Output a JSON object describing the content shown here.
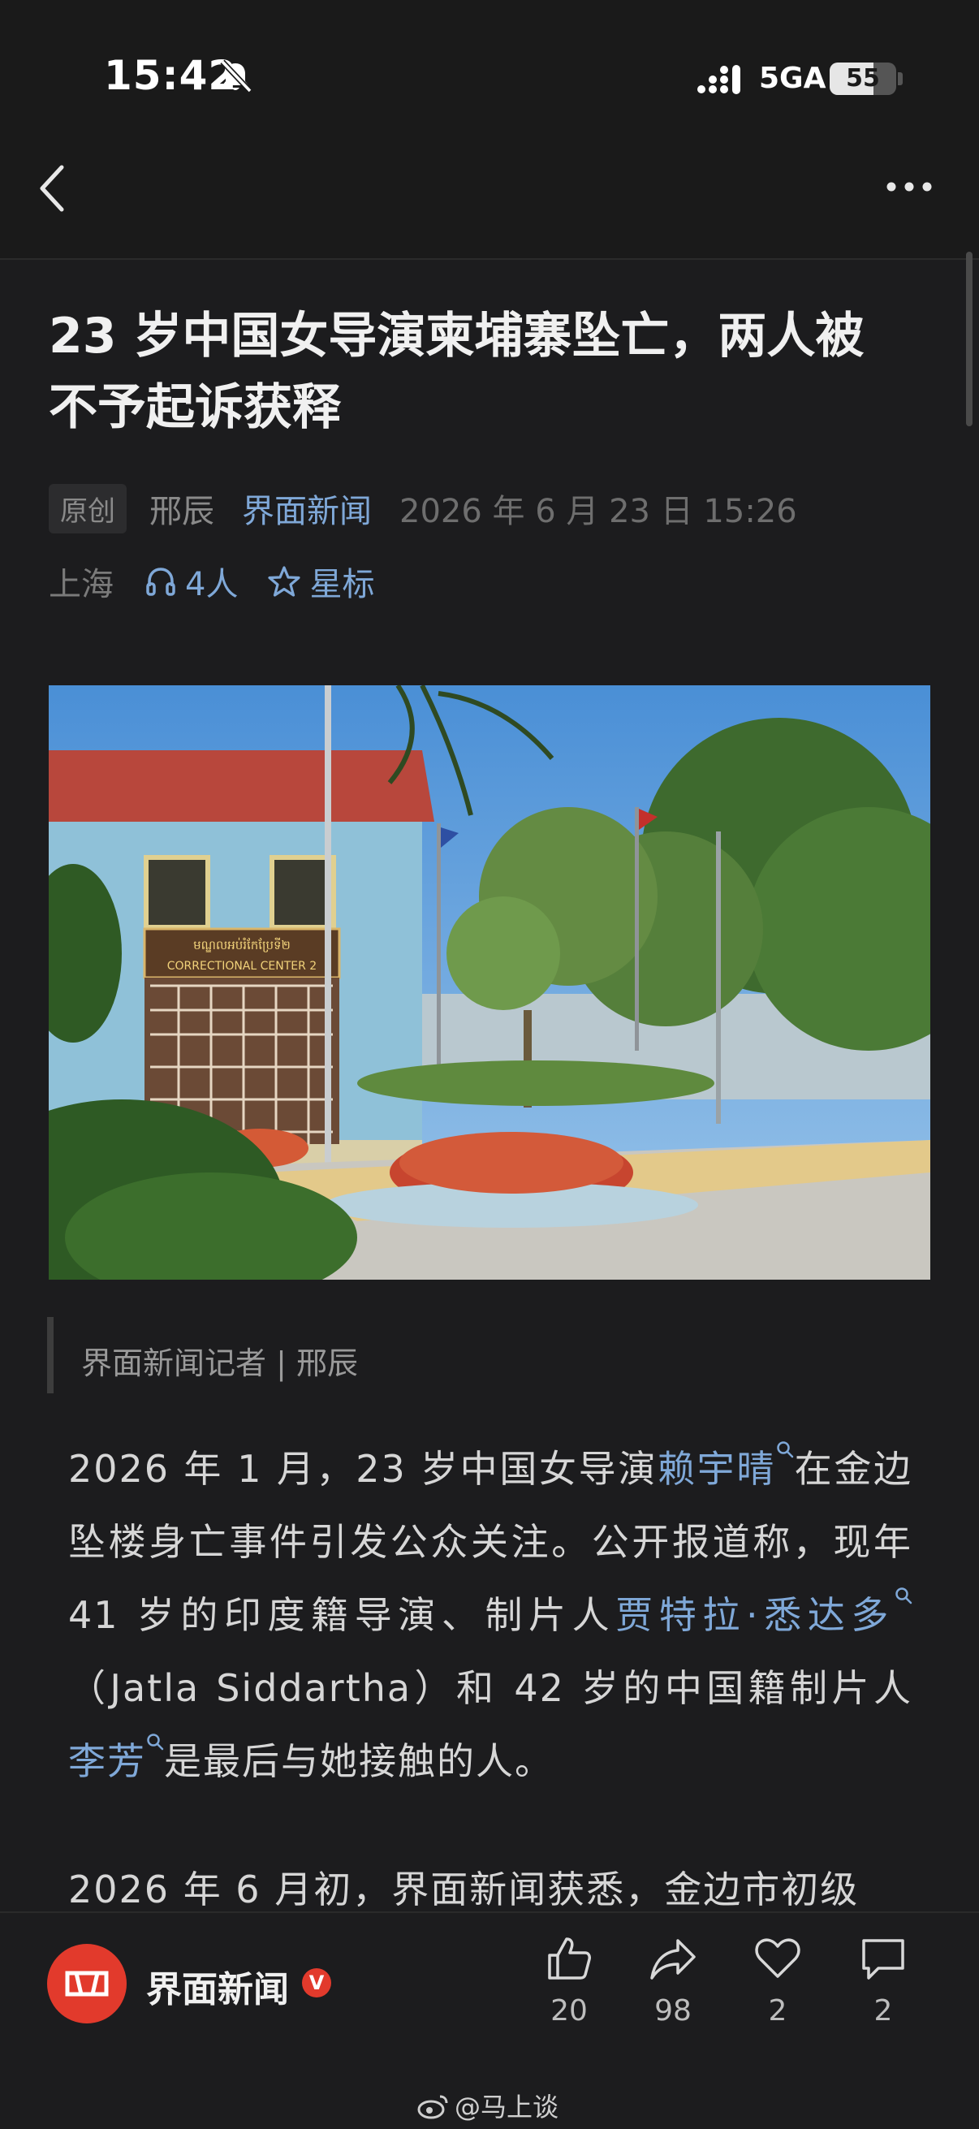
{
  "status_bar": {
    "time": "15:42",
    "network": "5GA",
    "battery": "55"
  },
  "article": {
    "title": "23 岁中国女导演柬埔寨坠亡，两人被不予起诉获释",
    "tag": "原创",
    "author": "邢辰",
    "source": "界面新闻",
    "datetime": "2026 年 6 月 23 日  15:26",
    "location": "上海",
    "listeners": "4人",
    "star_label": "星标",
    "byline": "界面新闻记者 | 邢辰",
    "p1_a": "2026 年 1 月，23 岁中国女导演",
    "p1_link1": "赖宇晴",
    "p1_b": "在金边坠楼身亡事件引发公众关注。公开报道称，现年 41 岁的印度籍导演、制片人",
    "p1_link2": "贾特拉·悉达多",
    "p1_c": "（Jatla Siddartha）和 42 岁的中国籍制片人",
    "p1_link3": "李芳",
    "p1_d": "是最后与她接触的人。",
    "p2": "2026 年 6 月初，界面新闻获悉，金边市初级"
  },
  "photo": {
    "sign_khmer": "មណ្ឌលអប់រំកែប្រែទី២",
    "sign_english": "CORRECTIONAL CENTER 2"
  },
  "bottom": {
    "publisher": "界面新闻",
    "verified_mark": "V",
    "likes": "20",
    "shares": "98",
    "favorites": "2",
    "comments": "2"
  },
  "watermark": "@马上谈",
  "colors": {
    "background": "#1c1c1e",
    "link": "#7fa8d8",
    "brand_red": "#e23a2c"
  },
  "icons": [
    "bell-off-icon",
    "signal-icon",
    "battery-icon",
    "back-icon",
    "more-icon",
    "headphones-icon",
    "star-icon",
    "search-icon",
    "thumbs-up-icon",
    "share-icon",
    "heart-icon",
    "comment-icon",
    "weibo-icon"
  ]
}
